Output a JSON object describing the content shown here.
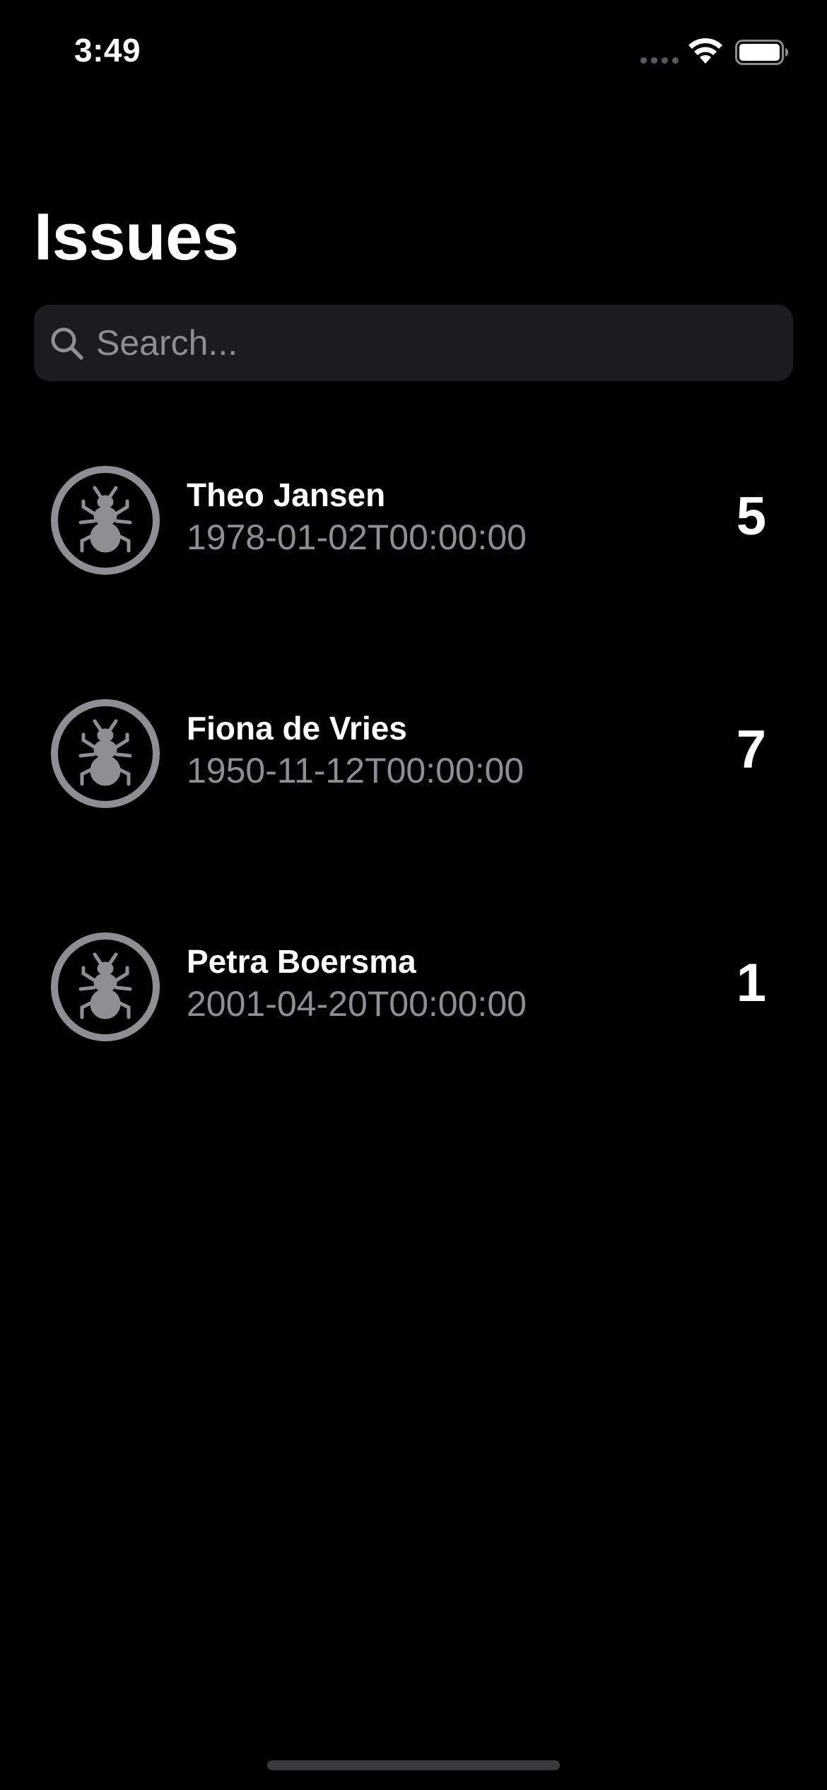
{
  "status_bar": {
    "time": "3:49"
  },
  "title": "Issues",
  "search": {
    "placeholder": "Search...",
    "value": ""
  },
  "issues": [
    {
      "name": "Theo Jansen",
      "date": "1978-01-02T00:00:00",
      "count": "5",
      "icon": "ant-icon"
    },
    {
      "name": "Fiona de Vries",
      "date": "1950-11-12T00:00:00",
      "count": "7",
      "icon": "ant-icon"
    },
    {
      "name": "Petra Boersma",
      "date": "2001-04-20T00:00:00",
      "count": "1",
      "icon": "ant-icon"
    }
  ],
  "colors": {
    "background": "#000000",
    "search_field": "#1c1c1e",
    "secondary_text": "#8e8e93",
    "icon_gray": "#8e8e93",
    "primary_text": "#ffffff"
  }
}
